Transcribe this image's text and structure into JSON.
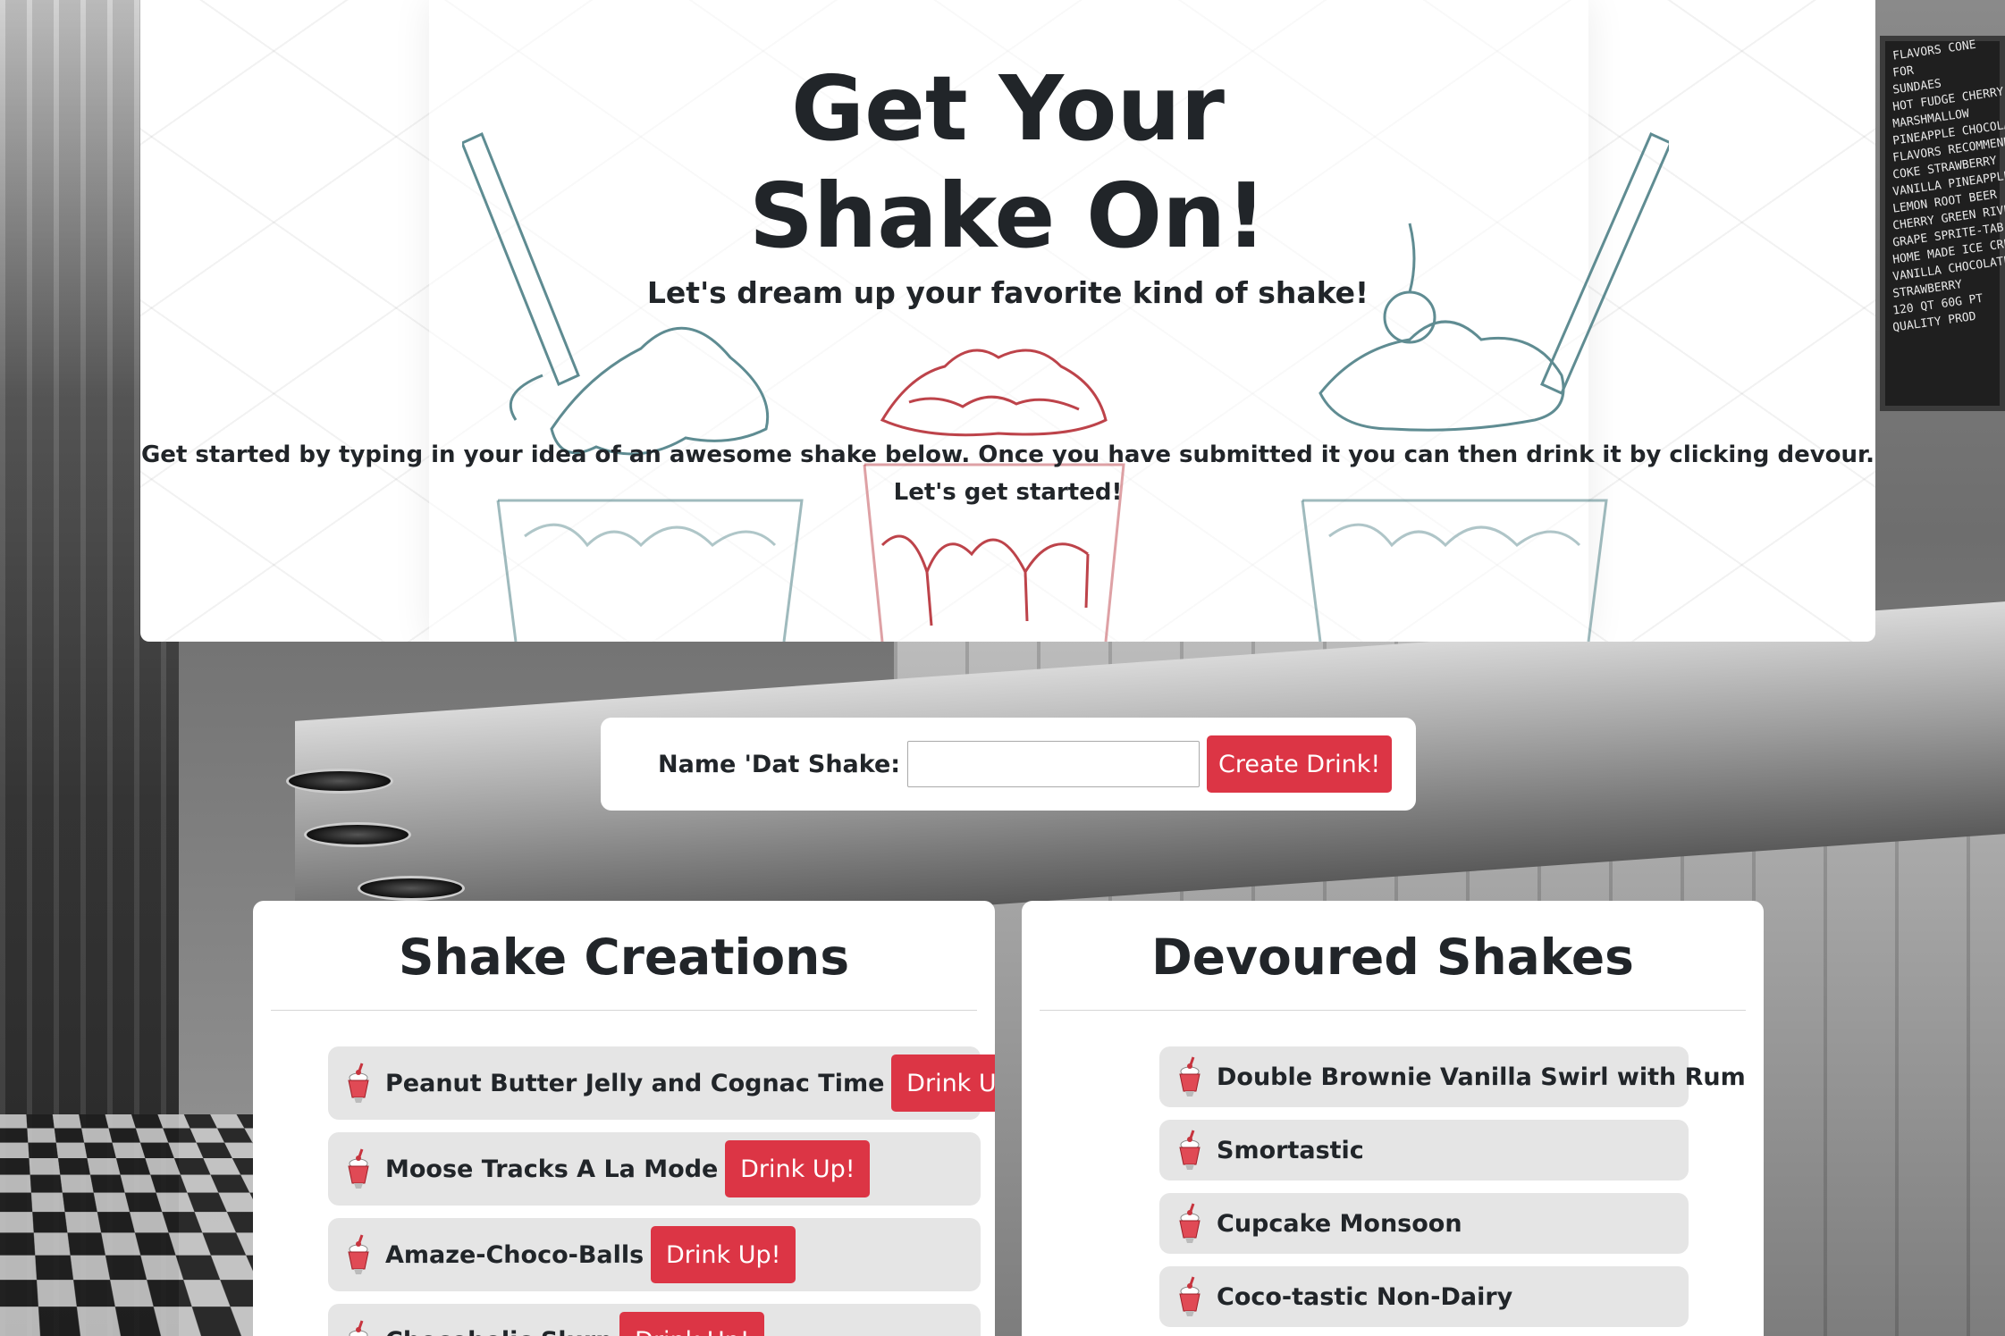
{
  "header": {
    "title": "Get Your Shake On!",
    "subtitle": "Let's dream up your favorite kind of shake!",
    "intro_line1": "Get started by typing in your idea of an awesome shake below. Once you have submitted it you can then drink it by clicking devour.",
    "intro_line2": "Let's get started!"
  },
  "form": {
    "label": "Name 'Dat Shake:",
    "input_value": "",
    "submit_label": "Create Drink!"
  },
  "creations": {
    "heading": "Shake Creations",
    "button_label": "Drink Up!",
    "items": [
      {
        "name": "Peanut Butter Jelly and Cognac Time"
      },
      {
        "name": "Moose Tracks A La Mode"
      },
      {
        "name": "Amaze-Choco-Balls"
      },
      {
        "name": "Chocoholic Slurp"
      }
    ]
  },
  "devoured": {
    "heading": "Devoured Shakes",
    "items": [
      {
        "name": "Double Brownie Vanilla Swirl with Rum"
      },
      {
        "name": "Smortastic"
      },
      {
        "name": "Cupcake Monsoon"
      },
      {
        "name": "Coco-tastic Non-Dairy"
      }
    ]
  },
  "background_menu_board": [
    "FLAVORS  CONE",
    "FOR",
    "SUNDAES",
    "HOT FUDGE CHERRY",
    "MARSHMALLOW",
    "PINEAPPLE CHOCOLATE",
    "FLAVORS RECOMMENDED",
    "COKE  STRAWBERRY",
    "VANILLA  PINEAPPLE",
    "LEMON   ROOT BEER",
    "CHERRY  GREEN RIVER",
    "GRAPE  SPRITE-TAB",
    "HOME MADE ICE CREAM",
    "VANILLA  CHOCOLATE",
    "STRAWBERRY",
    "120 QT 60G PT",
    "QUALITY PROD"
  ],
  "colors": {
    "accent_red": "#dc3545",
    "list_item_bg": "#e5e5e5",
    "panel_bg": "#ffffff",
    "text": "#212529",
    "teal_sketch": "#4d7f86",
    "red_sketch": "#b2232b"
  },
  "icons": {
    "shake": "milkshake-icon"
  }
}
